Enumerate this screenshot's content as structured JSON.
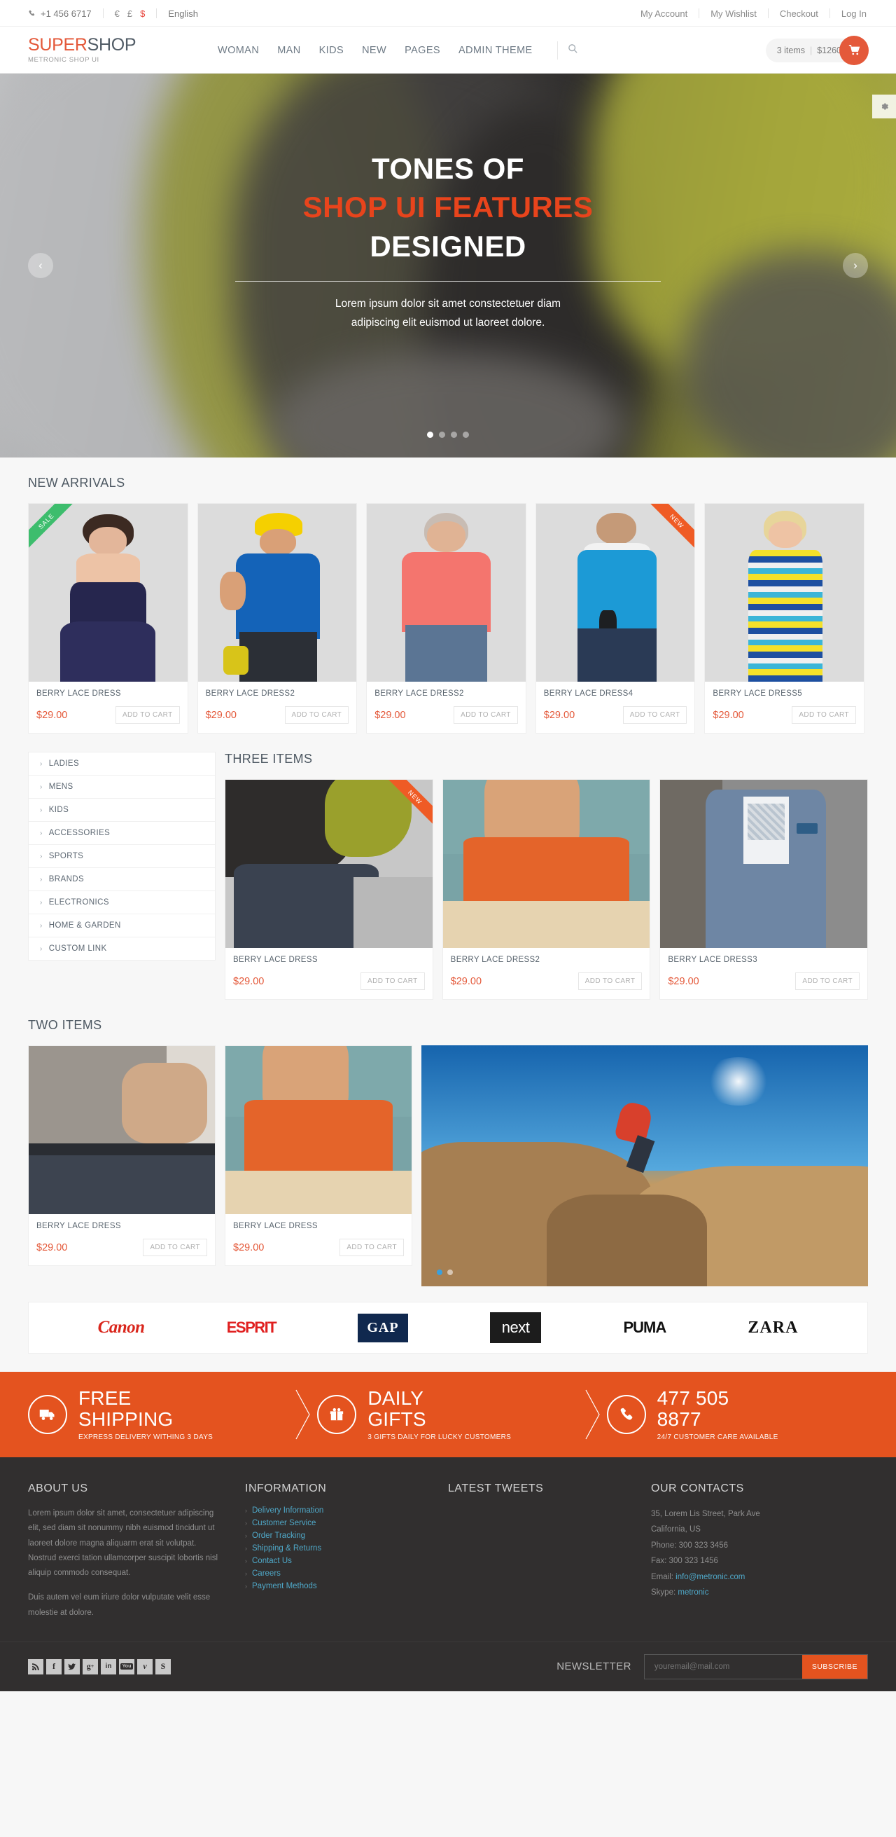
{
  "colors": {
    "accent": "#e4593a",
    "promo_bg": "#e4531f",
    "link": "#4fa8c8",
    "sale": "#3dbd6d",
    "new": "#ef5b25"
  },
  "pre_header": {
    "phone": "+1 456 6717",
    "currencies": [
      "€",
      "£",
      "$"
    ],
    "active_currency": "$",
    "language": "English",
    "links": [
      "My Account",
      "My Wishlist",
      "Checkout",
      "Log In"
    ]
  },
  "header": {
    "logo_part1": "SUPER",
    "logo_part2": "SHOP",
    "logo_sub": "METRONIC SHOP UI",
    "nav": [
      "WOMAN",
      "MAN",
      "KIDS",
      "NEW",
      "PAGES",
      "ADMIN THEME"
    ],
    "cart_items": "3 items",
    "cart_total": "$1260",
    "cart_sep": "|"
  },
  "slider": {
    "line1": "TONES OF",
    "line2": "SHOP UI FEATURES",
    "line3": "DESIGNED",
    "subtitle_1": "Lorem ipsum dolor sit amet constectetuer diam",
    "subtitle_2": "adipiscing elit euismod ut laoreet dolore.",
    "prev": "‹",
    "next": "›",
    "dots": 4,
    "active_dot": 0
  },
  "new_arrivals": {
    "title": "NEW ARRIVALS",
    "products": [
      {
        "name": "BERRY LACE DRESS",
        "price": "$29.00",
        "button": "ADD TO CART",
        "badge": "SALE",
        "badge_side": "left"
      },
      {
        "name": "BERRY LACE DRESS2",
        "price": "$29.00",
        "button": "ADD TO CART",
        "badge": "",
        "badge_side": ""
      },
      {
        "name": "BERRY LACE DRESS2",
        "price": "$29.00",
        "button": "ADD TO CART",
        "badge": "",
        "badge_side": ""
      },
      {
        "name": "BERRY LACE DRESS4",
        "price": "$29.00",
        "button": "ADD TO CART",
        "badge": "NEW",
        "badge_side": "right"
      },
      {
        "name": "BERRY LACE DRESS5",
        "price": "$29.00",
        "button": "ADD TO CART",
        "badge": "",
        "badge_side": ""
      }
    ]
  },
  "categories": [
    "LADIES",
    "MENS",
    "KIDS",
    "ACCESSORIES",
    "SPORTS",
    "BRANDS",
    "ELECTRONICS",
    "HOME & GARDEN",
    "CUSTOM LINK"
  ],
  "three_items": {
    "title": "THREE ITEMS",
    "products": [
      {
        "name": "BERRY LACE DRESS",
        "price": "$29.00",
        "button": "ADD TO CART",
        "badge": "NEW",
        "badge_side": "right"
      },
      {
        "name": "BERRY LACE DRESS2",
        "price": "$29.00",
        "button": "ADD TO CART",
        "badge": "",
        "badge_side": ""
      },
      {
        "name": "BERRY LACE DRESS3",
        "price": "$29.00",
        "button": "ADD TO CART",
        "badge": "",
        "badge_side": ""
      }
    ]
  },
  "two_items": {
    "title": "TWO ITEMS",
    "products": [
      {
        "name": "BERRY LACE DRESS",
        "price": "$29.00",
        "button": "ADD TO CART",
        "badge": "",
        "badge_side": ""
      },
      {
        "name": "BERRY LACE DRESS",
        "price": "$29.00",
        "button": "ADD TO CART",
        "badge": "",
        "badge_side": ""
      }
    ]
  },
  "brands": [
    "Canon",
    "ESPRIT",
    "GAP",
    "next",
    "PUMA",
    "ZARA"
  ],
  "promo": [
    {
      "title_l1": "FREE",
      "title_l2": "SHIPPING",
      "sub": "EXPRESS DELIVERY WITHING 3 DAYS",
      "icon": "truck-icon"
    },
    {
      "title_l1": "DAILY",
      "title_l2": "GIFTS",
      "sub": "3 GIFTS DAILY FOR LUCKY CUSTOMERS",
      "icon": "gift-icon"
    },
    {
      "title_l1": "477 505",
      "title_l2": "8877",
      "sub": "24/7 CUSTOMER CARE AVAILABLE",
      "icon": "phone-icon"
    }
  ],
  "footer": {
    "about": {
      "title": "ABOUT US",
      "p1": "Lorem ipsum dolor sit amet, consectetuer adipiscing elit, sed diam sit nonummy nibh euismod tincidunt ut laoreet dolore magna aliquarm erat sit volutpat. Nostrud exerci tation ullamcorper suscipit lobortis nisl aliquip commodo consequat.",
      "p2": "Duis autem vel eum iriure dolor vulputate velit esse molestie at dolore."
    },
    "information": {
      "title": "INFORMATION",
      "links": [
        "Delivery Information",
        "Customer Service",
        "Order Tracking",
        "Shipping & Returns",
        "Contact Us",
        "Careers",
        "Payment Methods"
      ]
    },
    "tweets": {
      "title": "LATEST TWEETS"
    },
    "contacts": {
      "title": "OUR CONTACTS",
      "address_1": "35, Lorem Lis Street, Park Ave",
      "address_2": "California, US",
      "phone": "Phone: 300 323 3456",
      "fax": "Fax: 300 323 1456",
      "email_label": "Email: ",
      "email": "info@metronic.com",
      "skype_label": "Skype: ",
      "skype": "metronic"
    },
    "socials": [
      "rss-icon",
      "facebook-icon",
      "twitter-icon",
      "google-plus-icon",
      "linkedin-icon",
      "youtube-icon",
      "vimeo-icon",
      "skype-icon"
    ],
    "newsletter_label": "NEWSLETTER",
    "newsletter_placeholder": "youremail@mail.com",
    "subscribe_label": "SUBSCRIBE"
  }
}
